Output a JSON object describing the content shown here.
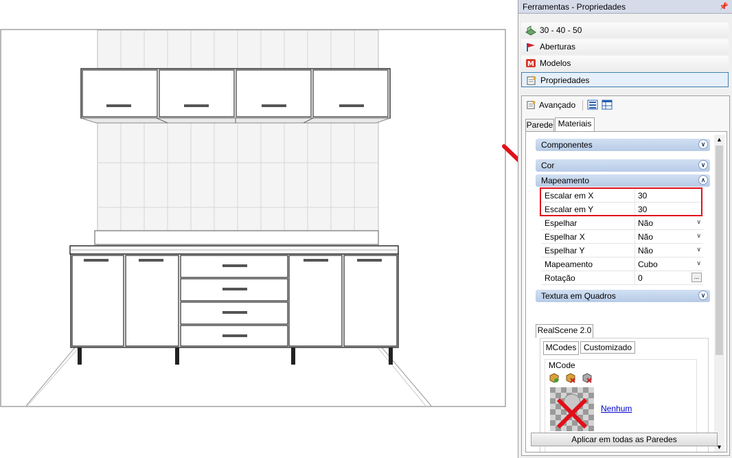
{
  "panel": {
    "title": "Ferramentas - Propriedades",
    "pin_icon": "pin-icon"
  },
  "nav": {
    "items": [
      {
        "label": "30 - 40 - 50",
        "icon": "room-3d-icon"
      },
      {
        "label": "Aberturas",
        "icon": "door-flag-icon"
      },
      {
        "label": "Modelos",
        "icon": "models-m-icon"
      },
      {
        "label": "Propriedades",
        "icon": "properties-sheet-icon",
        "selected": true
      }
    ]
  },
  "toolbar": {
    "avancado_label": "Avançado"
  },
  "tabs": {
    "parede": "Parede",
    "materiais": "Materiais"
  },
  "groups": {
    "componentes": "Componentes",
    "cor": "Cor",
    "mapeamento": "Mapeamento",
    "textura": "Textura em Quadros"
  },
  "properties": [
    {
      "key": "Escalar em X",
      "value": "30"
    },
    {
      "key": "Escalar em Y",
      "value": "30"
    },
    {
      "key": "Espelhar",
      "value": "Não"
    },
    {
      "key": "Espelhar X",
      "value": "Não"
    },
    {
      "key": "Espelhar Y",
      "value": "Não"
    },
    {
      "key": "Mapeamento",
      "value": "Cubo"
    },
    {
      "key": "Rotação",
      "value": "0"
    }
  ],
  "realscene": {
    "tab": "RealScene 2.0",
    "subtabs": {
      "mcodes": "MCodes",
      "customizado": "Customizado"
    },
    "mcode_label": "MCode",
    "none_link": "Nenhum"
  },
  "apply_button": "Aplicar em todas as Paredes",
  "colors": {
    "highlight": "#e0101a",
    "group_header": "#c4d5ec",
    "link": "#0000cc"
  }
}
